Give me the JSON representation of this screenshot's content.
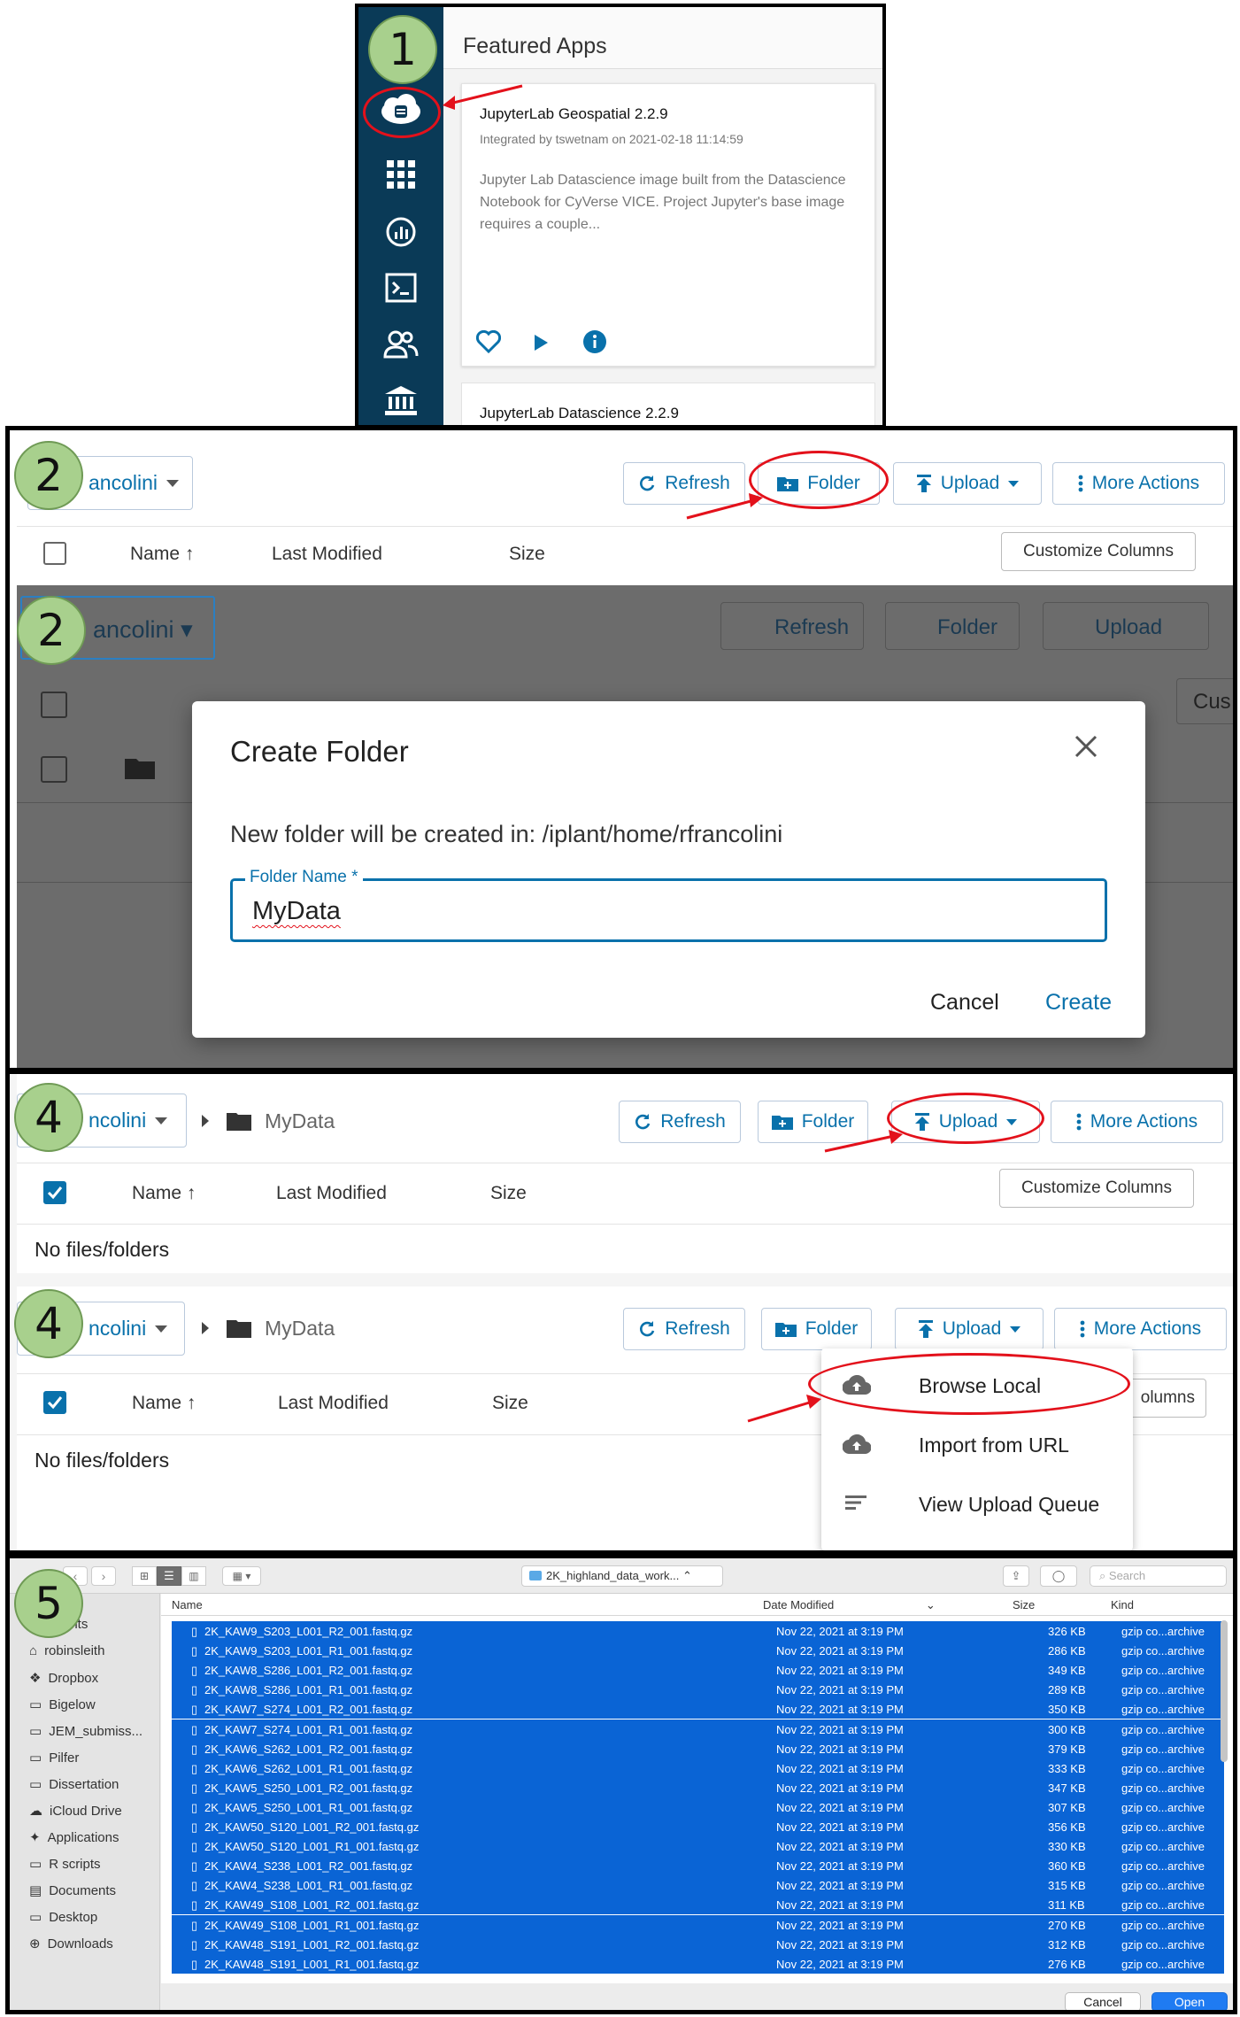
{
  "steps": {
    "s1": "1",
    "s2a": "2",
    "s2b": "2",
    "s4a": "4",
    "s4b": "4",
    "s5": "5"
  },
  "panel1": {
    "featured_title": "Featured Apps",
    "card_title": "JupyterLab Geospatial 2.2.9",
    "card_meta": "Integrated by tswetnam on 2021-02-18 11:14:59",
    "card_desc": "Jupyter Lab Datascience image built from the Datascience Notebook for CyVerse VICE. Project Jupyter's base image requires a couple...",
    "card2_title": "JupyterLab Datascience 2.2.9",
    "nav_icons": [
      "apps-cloud-icon",
      "grid-icon",
      "analyses-icon",
      "terminal-icon",
      "teams-icon",
      "collections-icon"
    ]
  },
  "toolbar": {
    "user_label": "ancolini",
    "user_label_2": "ancolini",
    "user_label_4": "ncolini",
    "refresh": "Refresh",
    "folder": "Folder",
    "upload": "Upload",
    "more_actions": "More Actions",
    "customize_columns": "Customize Columns",
    "cus_cut": "Cus"
  },
  "columns": {
    "name": "Name",
    "last_modified": "Last Modified",
    "size": "Size"
  },
  "dialog": {
    "title": "Create Folder",
    "info": "New folder will be created in: /iplant/home/rfrancolini",
    "field_label": "Folder Name *",
    "field_value": "MyData",
    "cancel": "Cancel",
    "create": "Create"
  },
  "panel4": {
    "breadcrumb": "MyData",
    "empty": "No files/folders",
    "menu": [
      "Browse Local",
      "Import from URL",
      "View Upload Queue"
    ],
    "columns_cut": "olumns"
  },
  "finder": {
    "path": "2K_highland_data_work...",
    "search_placeholder": "Search",
    "col_name": "Name",
    "col_date": "Date Modified",
    "col_size": "Size",
    "col_kind": "Kind",
    "sidebar": [
      "ents",
      "robinsleith",
      "Dropbox",
      "Bigelow",
      "JEM_submiss...",
      "Pilfer",
      "Dissertation",
      "iCloud Drive",
      "Applications",
      "R scripts",
      "Documents",
      "Desktop",
      "Downloads"
    ],
    "files": [
      {
        "name": "2K_KAW9_S203_L001_R2_001.fastq.gz",
        "date": "Nov 22, 2021 at 3:19 PM",
        "size": "326 KB",
        "kind": "gzip co...archive"
      },
      {
        "name": "2K_KAW9_S203_L001_R1_001.fastq.gz",
        "date": "Nov 22, 2021 at 3:19 PM",
        "size": "286 KB",
        "kind": "gzip co...archive"
      },
      {
        "name": "2K_KAW8_S286_L001_R2_001.fastq.gz",
        "date": "Nov 22, 2021 at 3:19 PM",
        "size": "349 KB",
        "kind": "gzip co...archive"
      },
      {
        "name": "2K_KAW8_S286_L001_R1_001.fastq.gz",
        "date": "Nov 22, 2021 at 3:19 PM",
        "size": "289 KB",
        "kind": "gzip co...archive"
      },
      {
        "name": "2K_KAW7_S274_L001_R2_001.fastq.gz",
        "date": "Nov 22, 2021 at 3:19 PM",
        "size": "350 KB",
        "kind": "gzip co...archive"
      },
      {
        "name": "2K_KAW7_S274_L001_R1_001.fastq.gz",
        "date": "Nov 22, 2021 at 3:19 PM",
        "size": "300 KB",
        "kind": "gzip co...archive"
      },
      {
        "name": "2K_KAW6_S262_L001_R2_001.fastq.gz",
        "date": "Nov 22, 2021 at 3:19 PM",
        "size": "379 KB",
        "kind": "gzip co...archive"
      },
      {
        "name": "2K_KAW6_S262_L001_R1_001.fastq.gz",
        "date": "Nov 22, 2021 at 3:19 PM",
        "size": "333 KB",
        "kind": "gzip co...archive"
      },
      {
        "name": "2K_KAW5_S250_L001_R2_001.fastq.gz",
        "date": "Nov 22, 2021 at 3:19 PM",
        "size": "347 KB",
        "kind": "gzip co...archive"
      },
      {
        "name": "2K_KAW5_S250_L001_R1_001.fastq.gz",
        "date": "Nov 22, 2021 at 3:19 PM",
        "size": "307 KB",
        "kind": "gzip co...archive"
      },
      {
        "name": "2K_KAW50_S120_L001_R2_001.fastq.gz",
        "date": "Nov 22, 2021 at 3:19 PM",
        "size": "356 KB",
        "kind": "gzip co...archive"
      },
      {
        "name": "2K_KAW50_S120_L001_R1_001.fastq.gz",
        "date": "Nov 22, 2021 at 3:19 PM",
        "size": "330 KB",
        "kind": "gzip co...archive"
      },
      {
        "name": "2K_KAW4_S238_L001_R2_001.fastq.gz",
        "date": "Nov 22, 2021 at 3:19 PM",
        "size": "360 KB",
        "kind": "gzip co...archive"
      },
      {
        "name": "2K_KAW4_S238_L001_R1_001.fastq.gz",
        "date": "Nov 22, 2021 at 3:19 PM",
        "size": "315 KB",
        "kind": "gzip co...archive"
      },
      {
        "name": "2K_KAW49_S108_L001_R2_001.fastq.gz",
        "date": "Nov 22, 2021 at 3:19 PM",
        "size": "311 KB",
        "kind": "gzip co...archive"
      },
      {
        "name": "2K_KAW49_S108_L001_R1_001.fastq.gz",
        "date": "Nov 22, 2021 at 3:19 PM",
        "size": "270 KB",
        "kind": "gzip co...archive"
      },
      {
        "name": "2K_KAW48_S191_L001_R2_001.fastq.gz",
        "date": "Nov 22, 2021 at 3:19 PM",
        "size": "312 KB",
        "kind": "gzip co...archive"
      },
      {
        "name": "2K_KAW48_S191_L001_R1_001.fastq.gz",
        "date": "Nov 22, 2021 at 3:19 PM",
        "size": "276 KB",
        "kind": "gzip co...archive"
      }
    ],
    "cancel": "Cancel",
    "open": "Open"
  },
  "colors": {
    "accent": "#0971ab",
    "red": "#e3111b",
    "badge": "#a8d08d",
    "sidebar_dark": "#0a3a57",
    "finder_select": "#0a64d5"
  }
}
